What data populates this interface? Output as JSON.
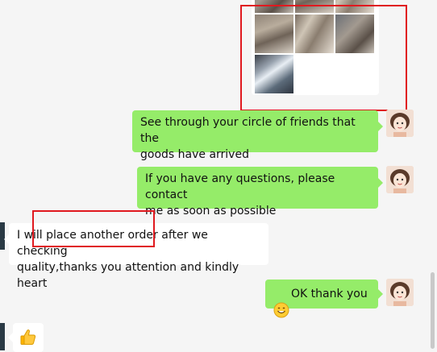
{
  "messages": [
    {
      "sender": "self",
      "type": "image-grid",
      "image_count": 7
    },
    {
      "sender": "self",
      "text": "See through your circle of friends that the\ngoods have arrived"
    },
    {
      "sender": "self",
      "text": "If you have any questions, please contact\nme as soon as possible"
    },
    {
      "sender": "other",
      "text": "I will place another order after we checking\nquality,thanks you attention and kindly heart"
    },
    {
      "sender": "self",
      "emoji": "smile-emoji-icon",
      "text": "OK  thank you"
    },
    {
      "sender": "other",
      "emoji": "thumbs-up-icon"
    }
  ],
  "colors": {
    "background": "#f5f5f5",
    "outgoing_bubble": "#95ec69",
    "incoming_bubble": "#ffffff",
    "annotation": "#e0191f"
  }
}
